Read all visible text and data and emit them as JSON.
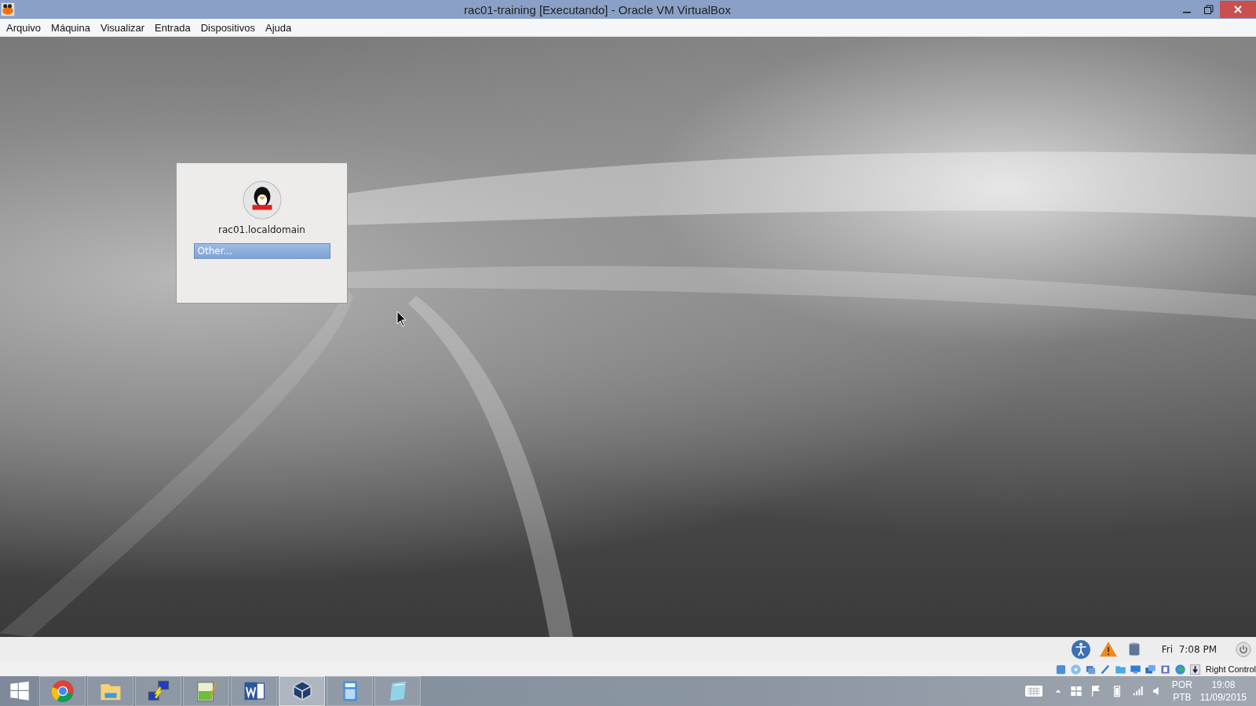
{
  "window": {
    "title": "rac01-training [Executando] - Oracle VM VirtualBox"
  },
  "menu": [
    "Arquivo",
    "Máquina",
    "Visualizar",
    "Entrada",
    "Dispositivos",
    "Ajuda"
  ],
  "login": {
    "host": "rac01.localdomain",
    "other": {
      "label": "Other...",
      "selected": true
    }
  },
  "guest_panel": {
    "day": "Fri",
    "time": "7:08 PM"
  },
  "status_bar": {
    "host_key": "Right Control"
  },
  "taskbar": {
    "apps": [
      {
        "kind": "chrome",
        "selected": false
      },
      {
        "kind": "folder",
        "selected": false
      },
      {
        "kind": "network",
        "selected": false
      },
      {
        "kind": "editor",
        "selected": false
      },
      {
        "kind": "word",
        "selected": false
      },
      {
        "kind": "virtualbox",
        "selected": true
      },
      {
        "kind": "calculator",
        "selected": false
      },
      {
        "kind": "notepad",
        "selected": false
      }
    ],
    "language": [
      "POR",
      "PTB"
    ],
    "time": "19:08",
    "date": "11/09/2015"
  }
}
